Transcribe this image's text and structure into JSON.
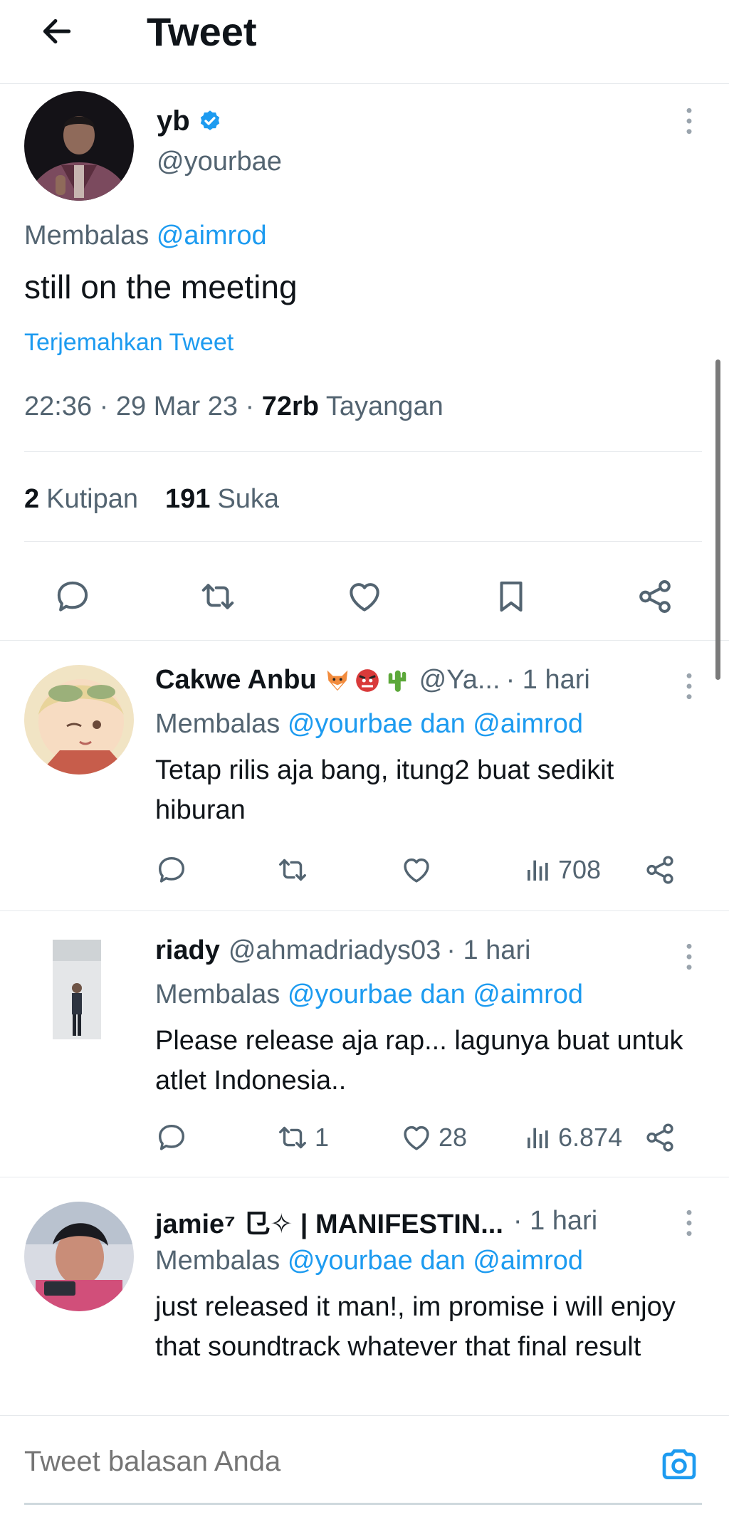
{
  "header": {
    "title": "Tweet"
  },
  "main_tweet": {
    "name": "yb",
    "handle": "@yourbae",
    "replying_prefix": "Membalas",
    "replying_to": "@aimrod",
    "text": "still on the meeting",
    "translate_label": "Terjemahkan Tweet",
    "time": "22:36",
    "date": "29 Mar 23",
    "views_count": "72rb",
    "views_label": "Tayangan",
    "quotes_count": "2",
    "quotes_label": "Kutipan",
    "likes_count": "191",
    "likes_label": "Suka"
  },
  "replies": [
    {
      "name": "Cakwe Anbu",
      "handle": "@Ya...",
      "time": "· 1 hari",
      "replying_prefix": "Membalas",
      "replying_to": "@yourbae dan @aimrod",
      "text": "Tetap rilis aja bang, itung2 buat sedikit hiburan",
      "retweets": "",
      "likes": "",
      "views": "708"
    },
    {
      "name": "riady",
      "handle": "@ahmadriadys03",
      "time": "· 1 hari",
      "replying_prefix": "Membalas",
      "replying_to": "@yourbae dan @aimrod",
      "text": "Please release aja rap... lagunya buat untuk atlet Indonesia..",
      "retweets": "1",
      "likes": "28",
      "views": "6.874"
    },
    {
      "name": "jamie⁷ ⺋✧ | MANIFESTIN...",
      "handle": "",
      "time": "· 1 hari",
      "replying_prefix": "Membalas",
      "replying_to": "@yourbae dan @aimrod",
      "text": "just released it man!, im promise i will enjoy that soundtrack whatever that final result",
      "retweets": "",
      "likes": "",
      "views": ""
    }
  ],
  "compose": {
    "placeholder": "Tweet balasan Anda"
  },
  "colors": {
    "accent": "#1d9bf0",
    "text": "#0f1419",
    "muted": "#536471",
    "divider": "#e6e9ec"
  },
  "icons": [
    "back-arrow-icon",
    "verified-badge-icon",
    "more-vertical-icon",
    "reply-icon",
    "retweet-icon",
    "like-icon",
    "bookmark-icon",
    "share-icon",
    "views-icon",
    "camera-icon",
    "fox-emoji-icon",
    "tengu-emoji-icon",
    "cactus-emoji-icon"
  ]
}
